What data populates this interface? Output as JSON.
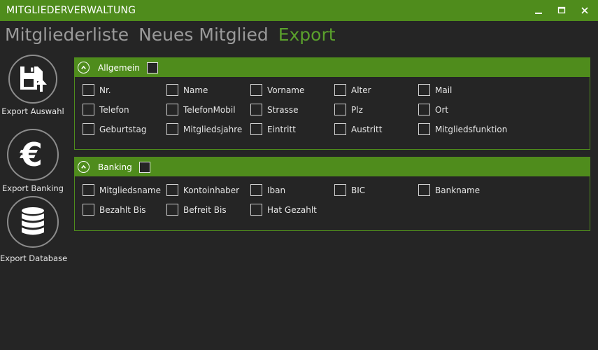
{
  "window": {
    "title": "MITGLIEDERVERWALTUNG",
    "controls": {
      "minimize": "minimize",
      "maximize": "maximize",
      "close": "close"
    }
  },
  "nav": {
    "tabs": [
      {
        "label": "Mitgliederliste",
        "active": false
      },
      {
        "label": "Neues Mitglied",
        "active": false
      },
      {
        "label": "Export",
        "active": true
      }
    ]
  },
  "sidebar": {
    "items": [
      {
        "label": "Export Auswahl",
        "icon": "floppy-export-icon"
      },
      {
        "label": "Export Banking",
        "icon": "euro-icon"
      },
      {
        "label": "Export Database",
        "icon": "database-icon"
      }
    ]
  },
  "groups": {
    "allgemein": {
      "title": "Allgemein",
      "checked": false,
      "fields": [
        "Nr.",
        "Name",
        "Vorname",
        "Alter",
        "Mail",
        "Telefon",
        "TelefonMobil",
        "Strasse",
        "Plz",
        "Ort",
        "Geburtstag",
        "Mitgliedsjahre",
        "Eintritt",
        "Austritt",
        "Mitgliedsfunktion"
      ]
    },
    "banking": {
      "title": "Banking",
      "checked": false,
      "fields": [
        "Mitgliedsname",
        "Kontoinhaber",
        "Iban",
        "BIC",
        "Bankname",
        "Bezahlt Bis",
        "Befreit Bis",
        "Hat Gezahlt"
      ]
    }
  },
  "colors": {
    "accent": "#4f8c1c",
    "active_tab": "#5aa02c",
    "background": "#252525",
    "inactive_tab": "#9a9a9a"
  }
}
